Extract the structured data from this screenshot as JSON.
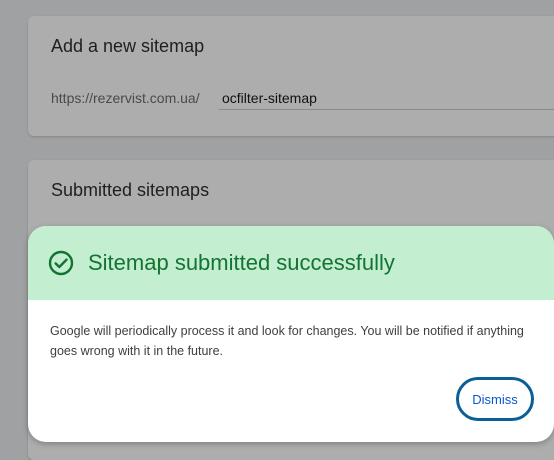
{
  "add_sitemap": {
    "title": "Add a new sitemap",
    "url_prefix": "https://rezervist.com.ua/",
    "input_value": "ocfilter-sitemap"
  },
  "submitted_sitemaps": {
    "title": "Submitted sitemaps"
  },
  "dialog": {
    "icon": "check-circle-icon",
    "title": "Sitemap submitted successfully",
    "body": "Google will periodically process it and look for changes. You will be notified if anything goes wrong with it in the future.",
    "dismiss_label": "Dismiss",
    "colors": {
      "header_bg": "#c4eed0",
      "success": "#137333",
      "link": "#0b57d0",
      "focus_ring": "#0b5e96"
    }
  }
}
